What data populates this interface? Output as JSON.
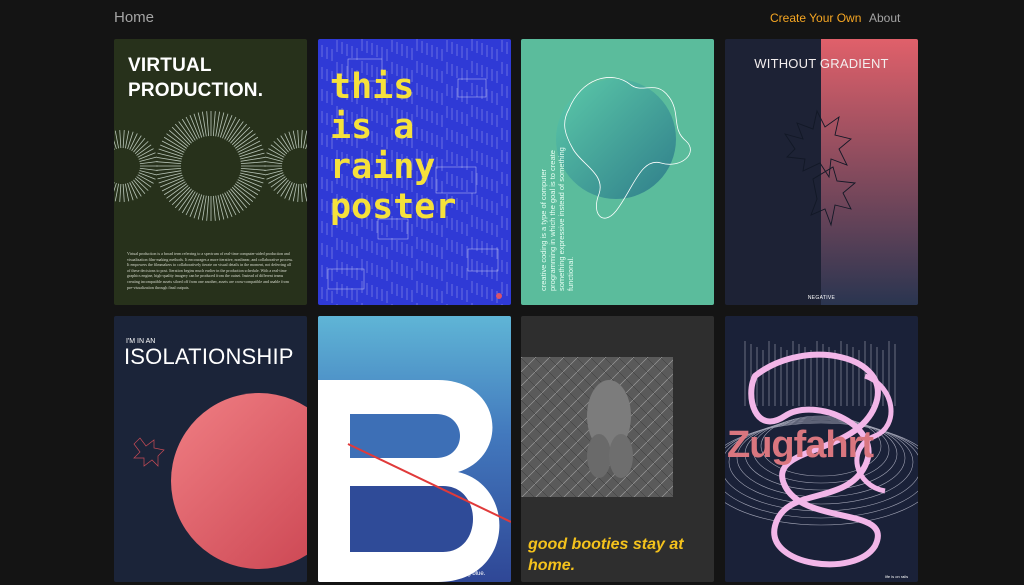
{
  "nav": {
    "home_label": "Home",
    "create_label": "Create Your Own",
    "about_label": "About",
    "accent_color": "#f5a623"
  },
  "posters": [
    {
      "title": "VIRTUAL\nPRODUCTION.",
      "body": "Virtual production is a broad term referring to a spectrum of real-time computer-aided production and visualization film-making methods. It encourages a more iterative, nonlinear, and collaborative process. It empowers the filmmakers to collaboratively iterate on visual details in the moment, not deferring all of these decisions to post. Iteration begins much earlier in the production schedule. With a real-time graphics engine, high-quality imagery can be produced from the outset. Instead of different teams creating incompatible assets siloed off from one another, assets are cross-compatible and usable from pre-visualization through final outputs."
    },
    {
      "title": "this\nis a\nrainy\nposter"
    },
    {
      "text": "creative coding is a type of computer programming in which the goal is to create something expressive instead of something functional."
    },
    {
      "title": "WITHOUT  GRADIENT",
      "footer": "NEGATIVE"
    },
    {
      "small": "I'M IN AN",
      "title": "ISOLATIONSHIP"
    },
    {
      "footer": "feeling blue."
    },
    {
      "title": "good booties stay at home."
    },
    {
      "title": "Zugfahrt",
      "footer": "life is on rails"
    }
  ]
}
